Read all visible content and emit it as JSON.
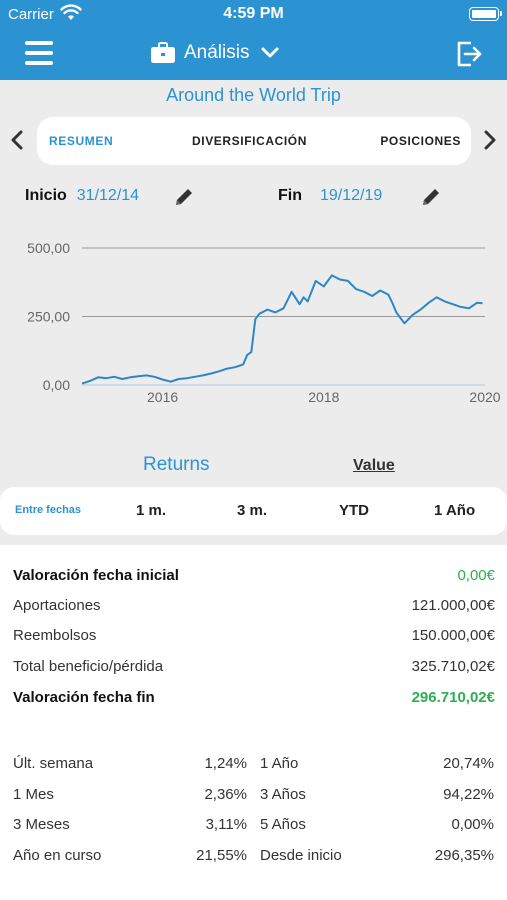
{
  "status": {
    "carrier": "Carrier",
    "time": "4:59 PM"
  },
  "nav": {
    "title": "Análisis"
  },
  "portfolio": {
    "name": "Around the World Trip"
  },
  "tabs": [
    {
      "label": "RESUMEN",
      "active": true
    },
    {
      "label": "DIVERSIFICACIÓN",
      "active": false
    },
    {
      "label": "POSICIONES",
      "active": false
    }
  ],
  "dates": {
    "start_label": "Inicio",
    "start_value": "31/12/14",
    "end_label": "Fin",
    "end_value": "19/12/19"
  },
  "chart_data": {
    "type": "line",
    "title": "",
    "xlabel": "",
    "ylabel": "",
    "xlim": [
      2015.0,
      2020.0
    ],
    "ylim": [
      0,
      500
    ],
    "x_ticks": [
      "2016",
      "2018",
      "2020"
    ],
    "y_ticks": [
      "0,00",
      "250,00",
      "500,00"
    ],
    "grid": true,
    "color": "#2c86c8",
    "series": [
      {
        "x": [
          2015.0,
          2015.1,
          2015.2,
          2015.3,
          2015.4,
          2015.5,
          2015.6,
          2015.7,
          2015.8,
          2015.9,
          2016.0,
          2016.1,
          2016.2,
          2016.3,
          2016.4,
          2016.5,
          2016.6,
          2016.7,
          2016.8,
          2016.9,
          2017.0,
          2017.05,
          2017.1,
          2017.15,
          2017.2,
          2017.3,
          2017.4,
          2017.5,
          2017.6,
          2017.7,
          2017.75,
          2017.8,
          2017.9,
          2018.0,
          2018.1,
          2018.2,
          2018.3,
          2018.4,
          2018.5,
          2018.6,
          2018.7,
          2018.8,
          2018.85,
          2018.9,
          2019.0,
          2019.1,
          2019.2,
          2019.3,
          2019.4,
          2019.5,
          2019.6,
          2019.7,
          2019.8,
          2019.9,
          2019.97
        ],
        "y": [
          5,
          15,
          28,
          25,
          30,
          22,
          28,
          32,
          35,
          30,
          20,
          12,
          22,
          25,
          30,
          35,
          42,
          50,
          60,
          65,
          75,
          110,
          120,
          240,
          260,
          275,
          265,
          280,
          340,
          295,
          320,
          305,
          380,
          360,
          400,
          385,
          380,
          350,
          340,
          325,
          345,
          330,
          300,
          265,
          225,
          255,
          275,
          300,
          320,
          305,
          295,
          285,
          280,
          300,
          298
        ]
      }
    ]
  },
  "toggles": {
    "returns": "Returns",
    "value": "Value"
  },
  "periods": [
    "Entre fechas",
    "1 m.",
    "3 m.",
    "YTD",
    "1 Año"
  ],
  "summary": [
    {
      "label": "Valoración fecha inicial",
      "value": "0,00€",
      "bold": true,
      "color": "green"
    },
    {
      "label": "Aportaciones",
      "value": "121.000,00€",
      "bold": false,
      "color": "default"
    },
    {
      "label": "Reembolsos",
      "value": "150.000,00€",
      "bold": false,
      "color": "default"
    },
    {
      "label": "Total beneficio/pérdida",
      "value": "325.710,02€",
      "bold": false,
      "color": "default"
    },
    {
      "label": "Valoración fecha fin",
      "value": "296.710,02€",
      "bold": true,
      "color": "green"
    }
  ],
  "returns": {
    "left": [
      {
        "label": "Últ. semana",
        "value": "1,24%",
        "color": "green"
      },
      {
        "label": "1 Mes",
        "value": "2,36%",
        "color": "green"
      },
      {
        "label": "3 Meses",
        "value": "3,11%",
        "color": "green"
      },
      {
        "label": "Año en curso",
        "value": "21,55%",
        "color": "green"
      }
    ],
    "right": [
      {
        "label": "1 Año",
        "value": "20,74%",
        "color": "green"
      },
      {
        "label": "3 Años",
        "value": "94,22%",
        "color": "green"
      },
      {
        "label": "5 Años",
        "value": "0,00%",
        "color": "red"
      },
      {
        "label": "Desde inicio",
        "value": "296,35%",
        "color": "green"
      }
    ]
  }
}
